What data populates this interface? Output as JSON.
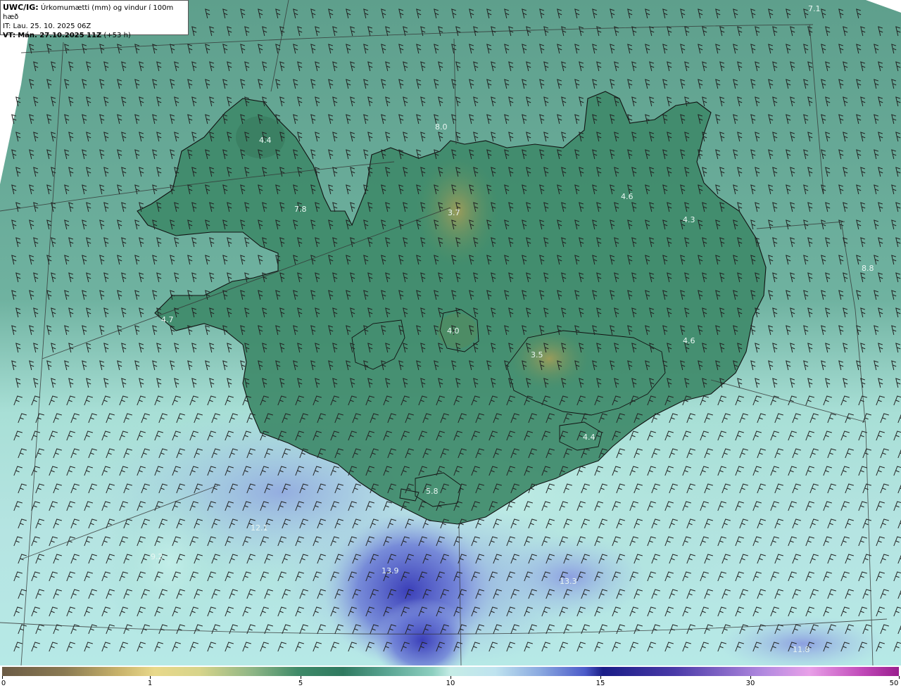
{
  "header": {
    "product": "UWC/IG:",
    "description": "Úrkomumætti (mm) og vindur í 100m hæð",
    "init_time": "IT: Lau. 25. 10. 2025 06Z",
    "valid_label": "VT:",
    "valid_time": "Mán. 27.10.2025 11Z",
    "lead": "(+53 h)"
  },
  "value_labels": [
    {
      "text": "7.1",
      "kind": "light"
    },
    {
      "text": "8.0",
      "kind": "light"
    },
    {
      "text": "4.4",
      "kind": "light"
    },
    {
      "text": "7.8",
      "kind": "light"
    },
    {
      "text": "3.7",
      "kind": "light"
    },
    {
      "text": "4.6",
      "kind": "light"
    },
    {
      "text": "4.3",
      "kind": "light"
    },
    {
      "text": "8.8",
      "kind": "light"
    },
    {
      "text": "4.7",
      "kind": "light"
    },
    {
      "text": "4.0",
      "kind": "light"
    },
    {
      "text": "3.5",
      "kind": "light"
    },
    {
      "text": "4.6",
      "kind": "light"
    },
    {
      "text": "4.4",
      "kind": "light"
    },
    {
      "text": "5.8",
      "kind": "light"
    },
    {
      "text": "12.1",
      "kind": "light"
    },
    {
      "text": "9.2",
      "kind": "light"
    },
    {
      "text": "13.9",
      "kind": "light"
    },
    {
      "text": "13.3",
      "kind": "light"
    },
    {
      "text": "11.8",
      "kind": "light"
    }
  ],
  "colorbar": {
    "ticks": [
      "0",
      "1",
      "5",
      "10",
      "15",
      "30",
      "50"
    ]
  },
  "colors": {
    "sea_green": "#5fa592",
    "land_green": "#3f8a6a",
    "high_yellow": "#8e9a58",
    "sea_light": "#b8e6de",
    "sea_blue": "#8a9fe0",
    "deep_blue": "#4b4fc4",
    "barb": "#222222",
    "coast": "#111111"
  }
}
